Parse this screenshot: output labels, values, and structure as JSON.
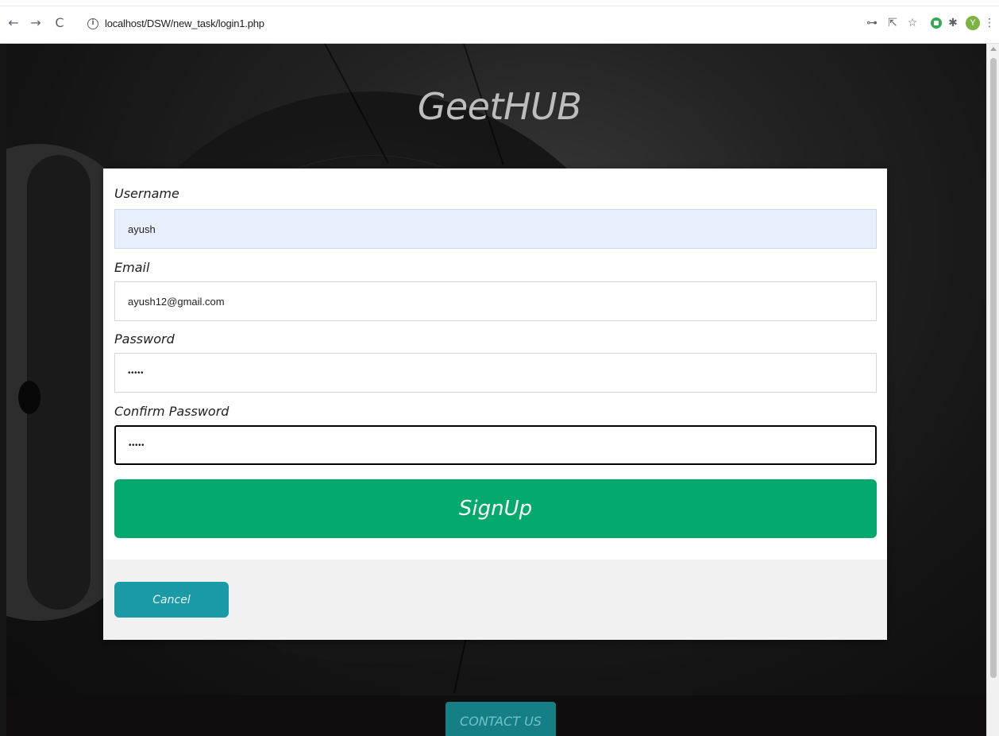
{
  "browser": {
    "back_icon": "←",
    "forward_icon": "→",
    "reload_icon": "C",
    "info_icon": "i",
    "url": "localhost/DSW/new_task/login1.php",
    "key_icon": "⊶",
    "share_icon": "⇱",
    "star_icon": "☆",
    "puzzle_icon": "✱",
    "avatar_letter": "Y",
    "menu_icon": "⋮"
  },
  "site": {
    "title": "GeetHUB"
  },
  "form": {
    "username_label": "Username",
    "username_value": "ayush",
    "email_label": "Email",
    "email_value": "ayush12@gmail.com",
    "password_label": "Password",
    "password_value": "•••••",
    "confirm_label": "Confirm Password",
    "confirm_value": "•••••",
    "signup_label": "SignUp",
    "cancel_label": "Cancel"
  },
  "footer": {
    "contact_label": "CONTACT US"
  },
  "colors": {
    "signup": "#04aa6d",
    "cancel": "#1a9aa5",
    "contact": "#167f86",
    "autofill": "#e8f0fe"
  }
}
